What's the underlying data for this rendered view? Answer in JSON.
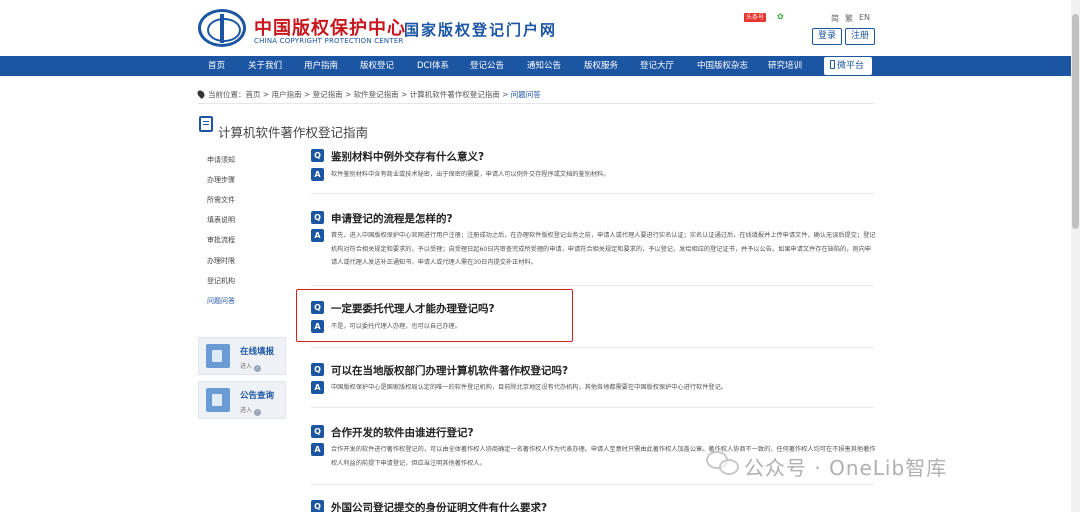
{
  "header": {
    "logo_cn": "中国版权保护中心",
    "logo_en": "CHINA COPYRIGHT PROTECTION CENTER",
    "portal": "国家版权登记门户网",
    "weibo": "头条号",
    "wechat": "✿",
    "lang": [
      "简",
      "繁",
      "EN"
    ],
    "login": "登录",
    "register": "注册"
  },
  "nav": {
    "items": [
      "首页",
      "关于我们",
      "用户指南",
      "版权登记",
      "DCI体系",
      "登记公告",
      "通知公告",
      "版权服务",
      "登记大厅",
      "中国版权杂志",
      "研究培训"
    ],
    "wechat": "微平台"
  },
  "breadcrumb": {
    "prefix": "当前位置：",
    "path": "首页 > 用户指南 > 登记指南 > 软件登记指南 > 计算机软件著作权登记指南 > ",
    "current": "问题问答"
  },
  "page_title": "计算机软件著作权登记指南",
  "sidebar": {
    "items": [
      "申请须知",
      "办理步骤",
      "所需文件",
      "填表说明",
      "审批流程",
      "办理时限",
      "登记机构",
      "问题问答"
    ],
    "cards": [
      {
        "title": "在线填报",
        "sub": "进入"
      },
      {
        "title": "公告查询",
        "sub": "进入"
      }
    ]
  },
  "qa": {
    "q_badge": "Q",
    "a_badge": "A",
    "items": [
      {
        "q": "鉴别材料中例外交存有什么意义?",
        "a": "软件鉴别材料中含有商业或技术秘密，出于保密的需要，申请人可以例外交存程序或文档的鉴别材料。"
      },
      {
        "q": "申请登记的流程是怎样的?",
        "a": "首先，进入中国版权保护中心官网进行用户注册；注册成功之后，在办理软件版权登记业务之前，申请人或代理人要进行实名认证；实名认证通过后，在线填报并上传申请文件，确认无误后提交；登记机构对符合相关规定和要求的，予以受理；自受理日起60日内审查完成所受理的申请，申请符合相关规定和要求的，予以登记，发给相应的登记证书，并予以公告。如果申请文件存在缺陷的，则向申请人或代理人发送补正通知书，申请人或代理人需在30日内提交补正材料。"
      },
      {
        "q": "一定要委托代理人才能办理登记吗?",
        "a": "不是，可以委托代理人办理，也可以自己办理。"
      },
      {
        "q": "可以在当地版权部门办理计算机软件著作权登记吗?",
        "a": "中国版权保护中心是国家版权局认定的唯一的软件登记机构，目前除北京地区设有代办机构，其他各地都需要在中国版权保护中心进行软件登记。"
      },
      {
        "q": "合作开发的软件由谁进行登记?",
        "a": "合作开发的软件进行著作权登记的，可以由全体著作权人协商确定一名著作权人作为代表办理。申请人至意时只需由此著作权人加盖公章。著作权人协商不一致的，任何著作权人均可在不损害其他著作权人利益的前提下申请登记，但应当注明其他著作权人。"
      },
      {
        "q": "外国公司登记提交的身份证明文件有什么要求?",
        "a": ""
      }
    ]
  },
  "watermark": "公众号 · OneLib智库"
}
